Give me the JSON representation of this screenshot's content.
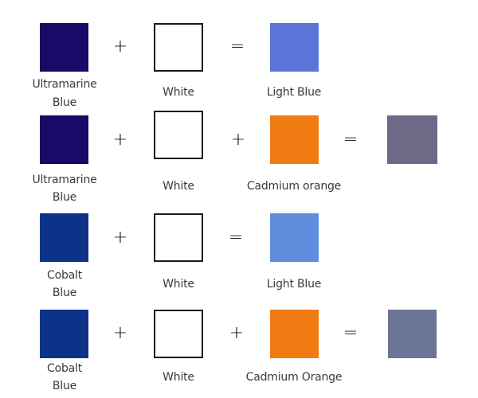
{
  "colors": {
    "ultramarine_blue": "#1a0966",
    "white": "#ffffff",
    "light_blue_1": "#5b74d9",
    "cadmium_orange": "#ef7b12",
    "result_grey_violet": "#6d6a88",
    "cobalt_blue": "#0d3389",
    "light_blue_2": "#5f8ddd",
    "result_grey_blue": "#6b7596"
  },
  "operators": {
    "plus": "+",
    "equals": "="
  },
  "rows": [
    {
      "inputs": [
        {
          "name": "Ultramarine",
          "name2": "Blue"
        },
        {
          "name": "White"
        }
      ],
      "result": {
        "name": "Light Blue"
      }
    },
    {
      "inputs": [
        {
          "name": "Ultramarine",
          "name2": "Blue"
        },
        {
          "name": "White"
        },
        {
          "name": "Cadmium orange"
        }
      ],
      "result": {
        "name": ""
      }
    },
    {
      "inputs": [
        {
          "name": "Cobalt",
          "name2": "Blue"
        },
        {
          "name": "White"
        }
      ],
      "result": {
        "name": "Light Blue"
      }
    },
    {
      "inputs": [
        {
          "name": "Cobalt",
          "name2": "Blue"
        },
        {
          "name": "White"
        },
        {
          "name": "Cadmium Orange"
        }
      ],
      "result": {
        "name": ""
      }
    }
  ]
}
